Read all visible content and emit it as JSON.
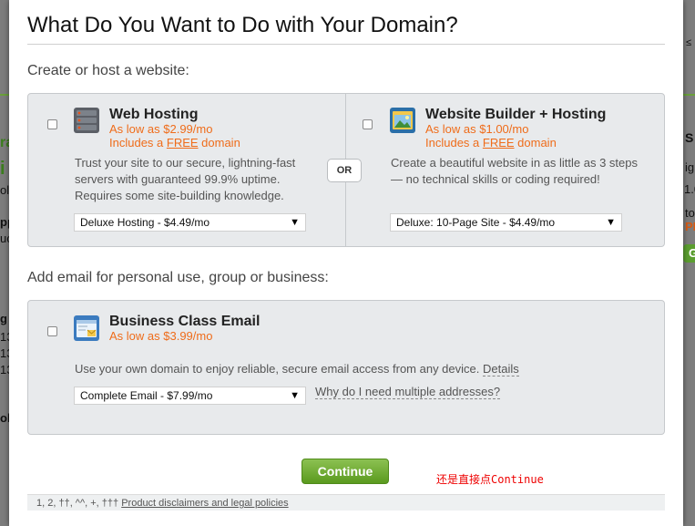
{
  "background": {
    "left_fragments": [
      "ra",
      "i",
      "ol",
      "pp",
      "uc",
      "g",
      "13",
      "13",
      "13",
      "ok"
    ],
    "right_fragments": [
      "S",
      "ig",
      "1.0",
      "to",
      "PR",
      "G",
      "≤"
    ],
    "accent_green": "#5b9e2f"
  },
  "modal": {
    "title": "What Do You Want to Do with Your Domain?",
    "hosting_section_label": "Create or host a website:",
    "email_section_label": "Add email for personal use, group or business:",
    "or_label": "OR",
    "continue_label": "Continue",
    "annotation": "还是直接点Continue",
    "footer": {
      "prefix": "1, 2, ††, ^^, +, †††",
      "link": "Product disclaimers and legal policies"
    }
  },
  "products": {
    "web_hosting": {
      "icon": "server-icon",
      "title": "Web Hosting",
      "price": "As low as $2.99/mo",
      "free_prefix": "Includes a ",
      "free_word": "FREE",
      "free_suffix": " domain",
      "desc": "Trust your site to our secure, lightning-fast servers with guaranteed 99.9% uptime. Requires some site-building knowledge.",
      "select_value": "Deluxe Hosting - $4.49/mo"
    },
    "website_builder": {
      "icon": "website-builder-icon",
      "title": "Website Builder + Hosting",
      "price": "As low as $1.00/mo",
      "free_prefix": "Includes a ",
      "free_word": "FREE",
      "free_suffix": " domain",
      "desc": "Create a beautiful website in as little as 3 steps — no technical skills or coding required!",
      "select_value": "Deluxe: 10-Page Site - $4.49/mo"
    },
    "business_email": {
      "icon": "email-icon",
      "title": "Business Class Email",
      "price": "As low as $3.99/mo",
      "desc": "Use your own domain to enjoy reliable, secure email access from any device.",
      "details_link": "Details",
      "select_value": "Complete Email - $7.99/mo",
      "why_link": "Why do I need multiple addresses?"
    }
  },
  "colors": {
    "price_orange": "#ef6c1a",
    "continue_green": "#5a9a1e",
    "annotation_red": "#e00000"
  }
}
